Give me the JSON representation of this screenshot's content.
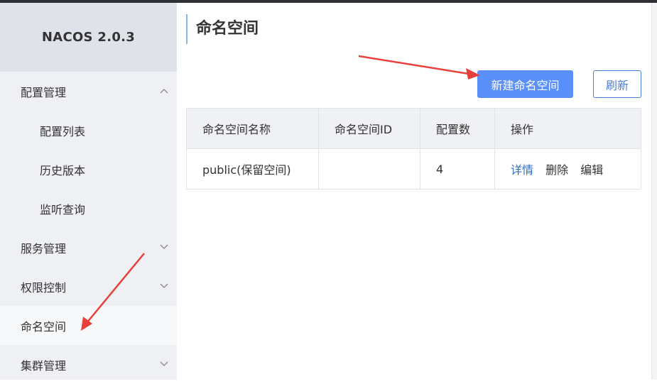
{
  "brand": {
    "title": "NACOS 2.0.3"
  },
  "sidebar": {
    "items": [
      {
        "label": "配置管理",
        "chevron": "chevron-up-icon"
      },
      {
        "label": "配置列表"
      },
      {
        "label": "历史版本"
      },
      {
        "label": "监听查询"
      },
      {
        "label": "服务管理",
        "chevron": "chevron-down-icon"
      },
      {
        "label": "权限控制",
        "chevron": "chevron-down-icon"
      },
      {
        "label": "命名空间",
        "active": true
      },
      {
        "label": "集群管理",
        "chevron": "chevron-down-icon"
      }
    ]
  },
  "main": {
    "title": "命名空间",
    "new_button": "新建命名空间",
    "refresh_button": "刷新",
    "table": {
      "headers": [
        "命名空间名称",
        "命名空间ID",
        "配置数",
        "操作"
      ],
      "rows": [
        {
          "name": "public(保留空间)",
          "id": "",
          "count": "4",
          "ops": [
            "详情",
            "删除",
            "编辑"
          ]
        }
      ]
    }
  },
  "colors": {
    "primary": "#5b8ff9",
    "link": "#2f6fc4",
    "sidebar_bg": "#eef0f4",
    "annotation_arrow": "#e8403a"
  }
}
